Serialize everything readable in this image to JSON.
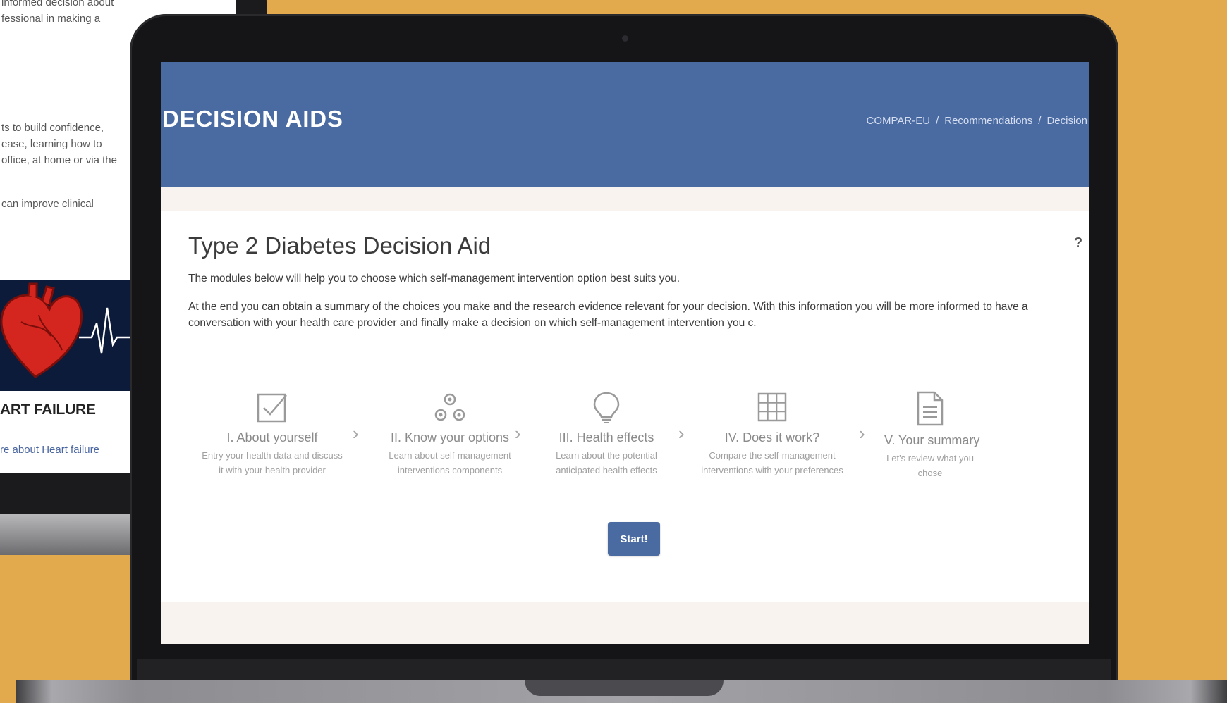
{
  "background_page": {
    "paragraph_1": "informed decision about\nfessional in making a",
    "paragraph_2": "ts to build confidence,\nease, learning how to\n office, at home or via the",
    "paragraph_3": "can improve clinical",
    "card_title": "ART FAILURE",
    "card_link": "re about Heart failure"
  },
  "header": {
    "title": "DECISION AIDS",
    "breadcrumb": [
      "COMPAR-EU",
      "Recommendations",
      "Decision"
    ],
    "breadcrumb_separator": "/"
  },
  "main": {
    "title": "Type 2 Diabetes Decision Aid",
    "help_icon": "question-icon",
    "intro_1": "The modules below will help you to choose which self-management intervention option best suits you.",
    "intro_2": "At the end you can obtain a summary of the choices you make and the research evidence relevant for your decision. With this information you will be more informed to have a conversation with your health care provider and finally make a decision on which self-management intervention you c.",
    "steps": [
      {
        "icon": "checkbox-icon",
        "title": "I. About yourself",
        "description": "Entry your health data and discuss it with your health provider"
      },
      {
        "icon": "gears-icon",
        "title": "II. Know your options",
        "description": "Learn about self-management interventions components"
      },
      {
        "icon": "lightbulb-icon",
        "title": "III. Health effects",
        "description": "Learn about the potential anticipated health effects"
      },
      {
        "icon": "grid-icon",
        "title": "IV. Does it work?",
        "description": "Compare the self-management interventions with your preferences"
      },
      {
        "icon": "document-icon",
        "title": "V. Your summary",
        "description": "Let's review what you chose"
      }
    ],
    "arrow_glyph": "›",
    "start_label": "Start!"
  },
  "colors": {
    "background": "#e2aa4c",
    "header": "#4a6aa2",
    "button": "#4a6aa2",
    "heart_panel": "#0d1b3a"
  }
}
